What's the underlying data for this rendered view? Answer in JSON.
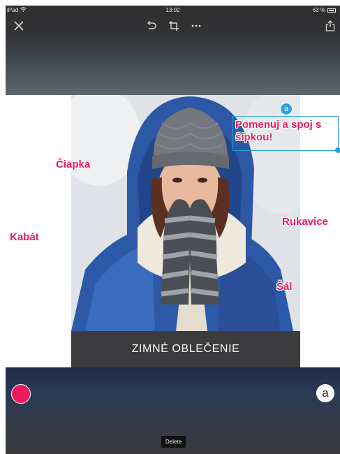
{
  "statusbar": {
    "device": "iPad",
    "time": "13:02",
    "battery": "63 %"
  },
  "toolbar": {
    "close_icon": "close-icon",
    "undo_icon": "undo-icon",
    "crop_icon": "crop-icon",
    "more_icon": "more-icon",
    "share_icon": "share-icon"
  },
  "canvas": {
    "caption": "ZIMNÉ OBLEČENIE",
    "labels": {
      "title": "Pomenuj a spoj s šípkou!",
      "ciapka": "Čiapka",
      "kabat": "Kabát",
      "rukavice": "Rukavice",
      "sal": "Šál"
    },
    "text_badge": "a"
  },
  "bottom": {
    "color_swatch": "#ec1b5e",
    "text_tool": "a",
    "delete_label": "Delete"
  },
  "colors": {
    "accent": "#ec1b5e",
    "selection": "#2aa0e0",
    "caption_bg": "#3c3c3e"
  }
}
